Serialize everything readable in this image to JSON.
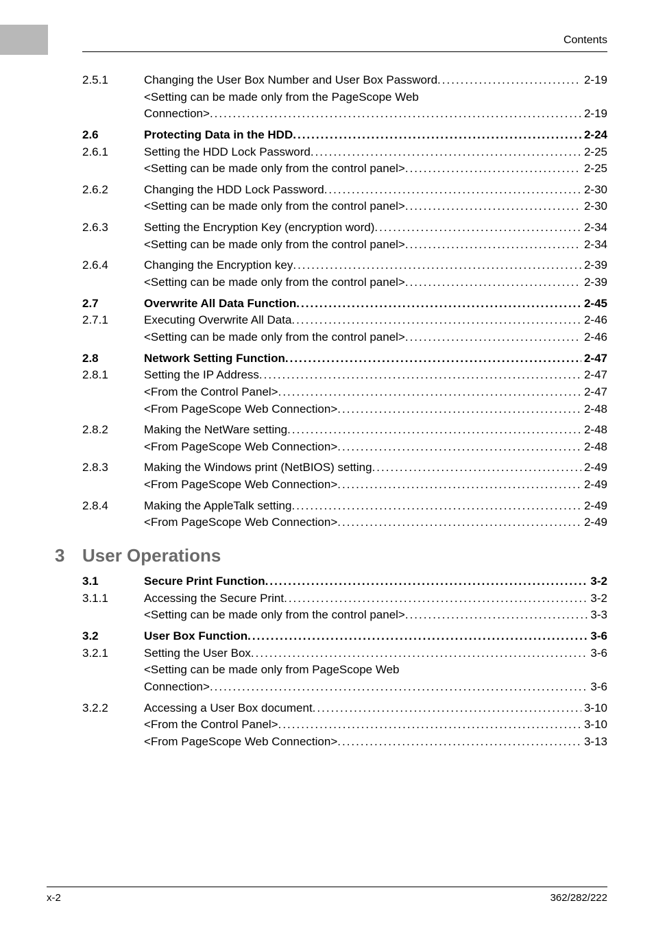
{
  "header": {
    "label": "Contents"
  },
  "footer": {
    "left": "x-2",
    "right": "362/282/222"
  },
  "chapter3": {
    "num": "3",
    "title": "User Operations"
  },
  "toc": [
    {
      "type": "row",
      "num": "2.5.1",
      "title": "Changing the User Box Number and User Box Password",
      "page": "2-19",
      "bold": false,
      "leader": true
    },
    {
      "type": "sub",
      "title": "<Setting can be made only from the PageScope Web",
      "leader": false
    },
    {
      "type": "sub",
      "title": "Connection>",
      "page": "2-19",
      "leader": true
    },
    {
      "type": "spacer"
    },
    {
      "type": "row",
      "num": "2.6",
      "title": "Protecting Data in the HDD",
      "page": "2-24",
      "bold": true,
      "leader": true
    },
    {
      "type": "row",
      "num": "2.6.1",
      "title": "Setting the HDD Lock Password",
      "page": "2-25",
      "bold": false,
      "leader": true
    },
    {
      "type": "sub",
      "title": "<Setting can be made only from the control panel>",
      "page": "2-25",
      "leader": true
    },
    {
      "type": "spacer"
    },
    {
      "type": "row",
      "num": "2.6.2",
      "title": "Changing the HDD Lock Password",
      "page": "2-30",
      "bold": false,
      "leader": true
    },
    {
      "type": "sub",
      "title": "<Setting can be made only from the control panel>",
      "page": "2-30",
      "leader": true
    },
    {
      "type": "spacer"
    },
    {
      "type": "row",
      "num": "2.6.3",
      "title": "Setting the Encryption Key (encryption word)",
      "page": "2-34",
      "bold": false,
      "leader": true
    },
    {
      "type": "sub",
      "title": "<Setting can be made only from the control panel>",
      "page": "2-34",
      "leader": true
    },
    {
      "type": "spacer"
    },
    {
      "type": "row",
      "num": "2.6.4",
      "title": "Changing the Encryption key",
      "page": "2-39",
      "bold": false,
      "leader": true
    },
    {
      "type": "sub",
      "title": "<Setting can be made only from the control panel>",
      "page": "2-39",
      "leader": true
    },
    {
      "type": "spacer"
    },
    {
      "type": "row",
      "num": "2.7",
      "title": "Overwrite All Data Function",
      "page": "2-45",
      "bold": true,
      "leader": true
    },
    {
      "type": "row",
      "num": "2.7.1",
      "title": "Executing Overwrite All Data",
      "page": "2-46",
      "bold": false,
      "leader": true
    },
    {
      "type": "sub",
      "title": "<Setting can be made only from the control panel>",
      "page": "2-46",
      "leader": true
    },
    {
      "type": "spacer"
    },
    {
      "type": "row",
      "num": "2.8",
      "title": "Network Setting Function",
      "page": "2-47",
      "bold": true,
      "leader": true
    },
    {
      "type": "row",
      "num": "2.8.1",
      "title": "Setting the IP Address",
      "page": "2-47",
      "bold": false,
      "leader": true
    },
    {
      "type": "sub",
      "title": "<From the Control Panel>",
      "page": "2-47",
      "leader": true
    },
    {
      "type": "sub",
      "title": "<From PageScope Web Connection>",
      "page": "2-48",
      "leader": true
    },
    {
      "type": "spacer"
    },
    {
      "type": "row",
      "num": "2.8.2",
      "title": "Making the NetWare setting",
      "page": "2-48",
      "bold": false,
      "leader": true
    },
    {
      "type": "sub",
      "title": "<From PageScope Web Connection>",
      "page": "2-48",
      "leader": true
    },
    {
      "type": "spacer"
    },
    {
      "type": "row",
      "num": "2.8.3",
      "title": "Making the Windows print (NetBIOS) setting",
      "page": "2-49",
      "bold": false,
      "leader": true
    },
    {
      "type": "sub",
      "title": "<From PageScope Web Connection>",
      "page": "2-49",
      "leader": true
    },
    {
      "type": "spacer"
    },
    {
      "type": "row",
      "num": "2.8.4",
      "title": "Making the AppleTalk setting",
      "page": "2-49",
      "bold": false,
      "leader": true
    },
    {
      "type": "sub",
      "title": "<From PageScope Web Connection>",
      "page": "2-49",
      "leader": true
    },
    {
      "type": "chapter"
    },
    {
      "type": "row",
      "num": "3.1",
      "title": "Secure Print Function",
      "page": "3-2",
      "bold": true,
      "leader": true
    },
    {
      "type": "row",
      "num": "3.1.1",
      "title": "Accessing the Secure Print",
      "page": "3-2",
      "bold": false,
      "leader": true
    },
    {
      "type": "sub",
      "title": "<Setting can be made only from the control panel>",
      "page": "3-3",
      "leader": true
    },
    {
      "type": "spacer"
    },
    {
      "type": "row",
      "num": "3.2",
      "title": "User Box Function",
      "page": "3-6",
      "bold": true,
      "leader": true
    },
    {
      "type": "row",
      "num": "3.2.1",
      "title": "Setting the User Box",
      "page": "3-6",
      "bold": false,
      "leader": true
    },
    {
      "type": "sub",
      "title": "<Setting can be made only from PageScope Web",
      "leader": false
    },
    {
      "type": "sub",
      "title": "Connection>",
      "page": "3-6",
      "leader": true
    },
    {
      "type": "spacer"
    },
    {
      "type": "row",
      "num": "3.2.2",
      "title": "Accessing a User Box document",
      "page": "3-10",
      "bold": false,
      "leader": true
    },
    {
      "type": "sub",
      "title": "<From the Control Panel>",
      "page": "3-10",
      "leader": true
    },
    {
      "type": "sub",
      "title": "<From PageScope Web Connection>",
      "page": "3-13",
      "leader": true
    }
  ]
}
